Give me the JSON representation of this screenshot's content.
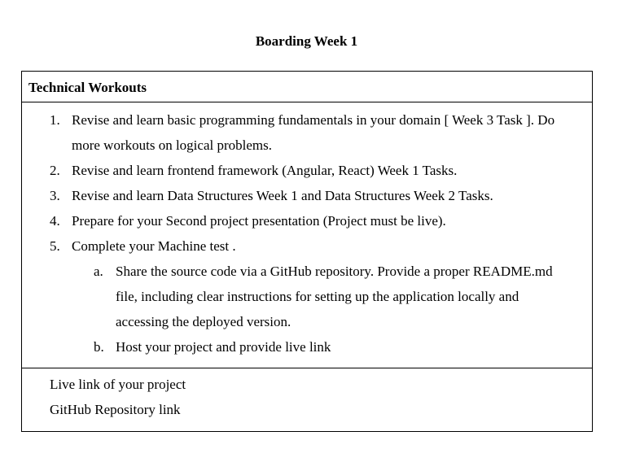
{
  "document": {
    "title": "Boarding Week 1"
  },
  "section": {
    "header": "Technical Workouts",
    "items": [
      {
        "number": "1.",
        "lines": [
          "Revise and learn basic programming fundamentals in your domain [ Week 3 Task ]. Do",
          "more workouts on logical problems."
        ]
      },
      {
        "number": "2.",
        "lines": [
          "Revise and learn frontend framework (Angular, React) Week 1 Tasks."
        ]
      },
      {
        "number": "3.",
        "lines": [
          "Revise and learn Data Structures Week 1 and Data Structures Week 2 Tasks."
        ]
      },
      {
        "number": "4.",
        "lines": [
          "Prepare for your Second project presentation (Project must be live)."
        ]
      },
      {
        "number": "5.",
        "lines": [
          "Complete your Machine test ."
        ],
        "subitems": [
          {
            "letter": "a.",
            "lines": [
              "Share the source code via a GitHub repository. Provide a proper README.md",
              "file, including clear instructions for setting up the application locally and",
              "accessing the deployed version."
            ]
          },
          {
            "letter": "b.",
            "lines": [
              "Host your project and provide live link"
            ]
          }
        ]
      }
    ]
  },
  "links": {
    "live_link": "Live link of your project",
    "github_link": "GitHub Repository link"
  }
}
